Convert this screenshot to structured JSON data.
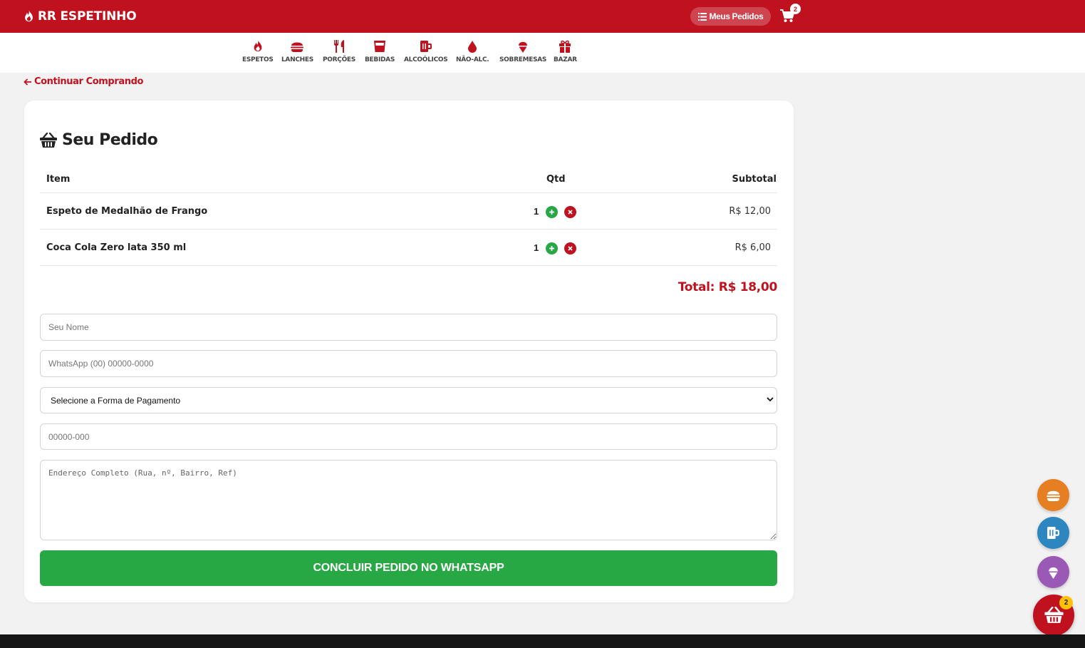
{
  "header": {
    "brand": "RR ESPETINHO",
    "orders_button": "Meus Pedidos",
    "cart_count": "2"
  },
  "categories": [
    {
      "label": "ESPETOS",
      "icon": "fire-icon"
    },
    {
      "label": "LANCHES",
      "icon": "burger-icon"
    },
    {
      "label": "PORÇÕES",
      "icon": "utensils-icon"
    },
    {
      "label": "BEBIDAS",
      "icon": "glass-icon"
    },
    {
      "label": "ALCOÓLICOS",
      "icon": "beer-mug-icon"
    },
    {
      "label": "NÃO-ALC.",
      "icon": "drop-icon"
    },
    {
      "label": "SOBREMESAS",
      "icon": "ice-cream-icon"
    },
    {
      "label": "BAZAR",
      "icon": "gift-icon"
    }
  ],
  "back_link": "Continuar Comprando",
  "order": {
    "title": "Seu Pedido",
    "columns": {
      "item": "Item",
      "qty": "Qtd",
      "subtotal": "Subtotal"
    },
    "items": [
      {
        "name": "Espeto de Medalhão de Frango",
        "qty": "1",
        "subtotal": "R$ 12,00"
      },
      {
        "name": "Coca Cola Zero lata 350 ml",
        "qty": "1",
        "subtotal": "R$ 6,00"
      }
    ],
    "total": "Total: R$ 18,00"
  },
  "form": {
    "name_placeholder": "Seu Nome",
    "whatsapp_placeholder": "WhatsApp (00) 00000-0000",
    "payment_selected": "Selecione a Forma de Pagamento",
    "cep_placeholder": "00000-000",
    "address_placeholder": "Endereço Completo (Rua, nº, Bairro, Ref)",
    "submit": "CONCLUIR PEDIDO NO WHATSAPP"
  },
  "floating": {
    "cart_count": "2",
    "buttons": [
      {
        "icon": "burger-icon",
        "color": "#e67e22"
      },
      {
        "icon": "beer-mug-icon",
        "color": "#2e86c1"
      },
      {
        "icon": "ice-cream-icon",
        "color": "#9b59b6"
      }
    ]
  },
  "colors": {
    "brand": "#c0111f",
    "success": "#28a745",
    "badge": "#ffc107"
  }
}
